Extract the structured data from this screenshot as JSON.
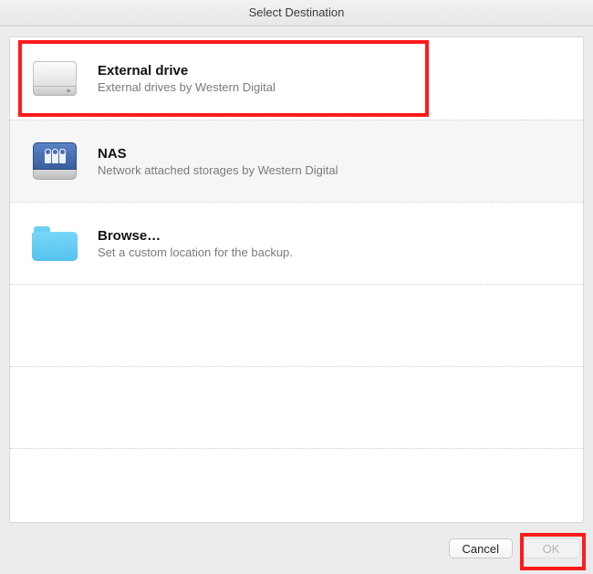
{
  "window": {
    "title": "Select Destination"
  },
  "options": [
    {
      "key": "external-drive",
      "title": "External drive",
      "subtitle": "External drives by Western Digital",
      "icon": "external-drive-icon",
      "highlighted": true
    },
    {
      "key": "nas",
      "title": "NAS",
      "subtitle": "Network attached storages by Western Digital",
      "icon": "nas-drive-icon",
      "highlighted": false
    },
    {
      "key": "browse",
      "title": "Browse…",
      "subtitle": "Set a custom location for the backup.",
      "icon": "folder-icon",
      "highlighted": false
    }
  ],
  "buttons": {
    "cancel": "Cancel",
    "ok": "OK",
    "ok_enabled": false,
    "ok_highlighted": true
  }
}
